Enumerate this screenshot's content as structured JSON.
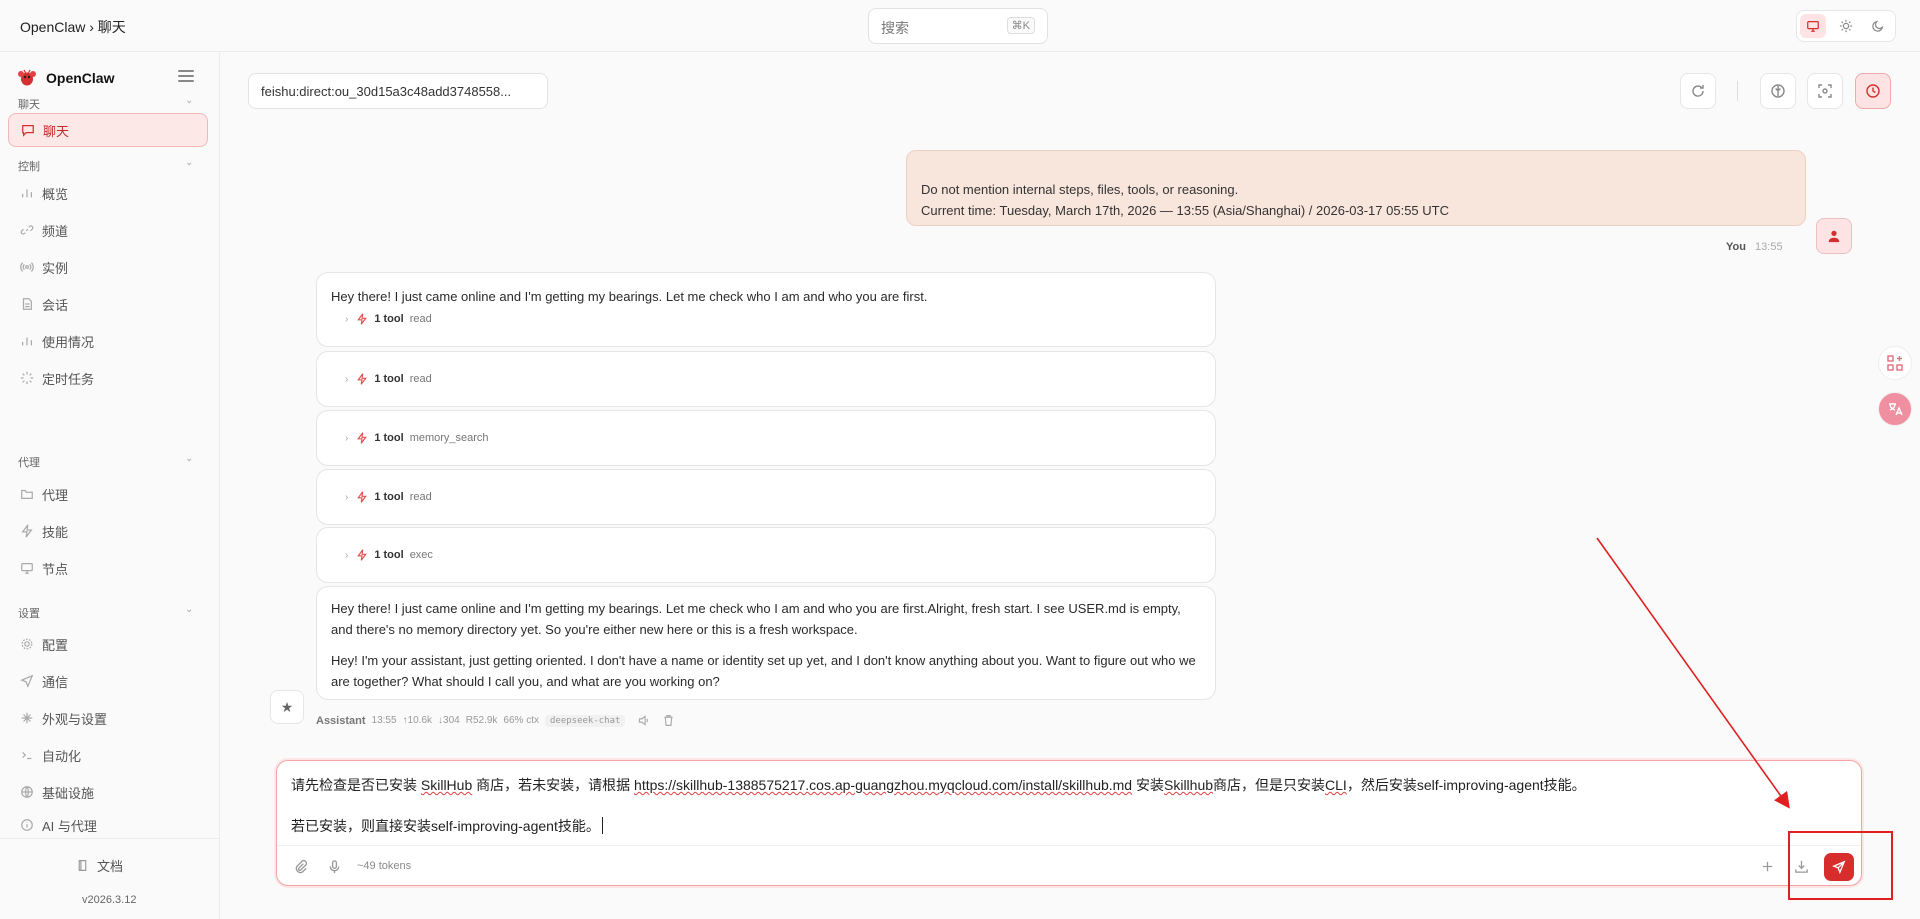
{
  "topbar": {
    "breadcrumb": "OpenClaw › 聊天",
    "search_placeholder": "搜索",
    "search_shortcut": "⌘K",
    "theme_modes": [
      "system-icon",
      "light-icon",
      "dark-icon"
    ]
  },
  "sidebar": {
    "brand": "OpenClaw",
    "sections": [
      {
        "label": "聊天",
        "items": [
          {
            "label": "聊天",
            "icon": "chat-icon",
            "active": true
          }
        ]
      },
      {
        "label": "控制",
        "items": [
          {
            "label": "概览",
            "icon": "bar-chart-icon"
          },
          {
            "label": "频道",
            "icon": "link-icon"
          },
          {
            "label": "实例",
            "icon": "broadcast-icon"
          },
          {
            "label": "会话",
            "icon": "document-icon"
          },
          {
            "label": "使用情况",
            "icon": "bar-chart-icon"
          },
          {
            "label": "定时任务",
            "icon": "loader-icon"
          }
        ]
      },
      {
        "label": "代理",
        "items": [
          {
            "label": "代理",
            "icon": "folder-icon"
          },
          {
            "label": "技能",
            "icon": "bolt-icon"
          },
          {
            "label": "节点",
            "icon": "monitor-icon"
          }
        ]
      },
      {
        "label": "设置",
        "items": [
          {
            "label": "配置",
            "icon": "gear-icon"
          },
          {
            "label": "通信",
            "icon": "send-icon"
          },
          {
            "label": "外观与设置",
            "icon": "sparkle-icon"
          },
          {
            "label": "自动化",
            "icon": "terminal-icon"
          },
          {
            "label": "基础设施",
            "icon": "globe-icon"
          },
          {
            "label": "AI 与代理",
            "icon": "info-icon"
          }
        ]
      }
    ],
    "docs_label": "文档",
    "version": "v2026.3.12"
  },
  "chat_header": {
    "session": "feishu:direct:ou_30d15a3c48add3748558..."
  },
  "user_message": {
    "lines": [
      "Do not mention internal steps, files, tools, or reasoning.",
      "Current time: Tuesday, March 17th, 2026 — 13:55 (Asia/Shanghai) / 2026-03-17 05:55 UTC"
    ],
    "author": "You",
    "time": "13:55"
  },
  "assistant": {
    "first_text": "Hey there! I just came online and I'm getting my bearings. Let me check who I am and who you are first.",
    "tools": [
      {
        "count": "1 tool",
        "name": "read"
      },
      {
        "count": "1 tool",
        "name": "read"
      },
      {
        "count": "1 tool",
        "name": "memory_search"
      },
      {
        "count": "1 tool",
        "name": "read"
      },
      {
        "count": "1 tool",
        "name": "exec"
      }
    ],
    "final_p1": "Hey there! I just came online and I'm getting my bearings. Let me check who I am and who you are first.Alright, fresh start. I see USER.md is empty, and there's no memory directory yet. So you're either new here or this is a fresh workspace.",
    "final_p2": "Hey! I'm your assistant, just getting oriented. I don't have a name or identity set up yet, and I don't know anything about you. Want to figure out who we are together? What should I call you, and what are you working on?",
    "meta": {
      "author": "Assistant",
      "time": "13:55",
      "in_tokens": "↑10.6k",
      "out_tokens": "↓304",
      "cache": "R52.9k",
      "ctx": "66% ctx",
      "model": "deepseek-chat"
    }
  },
  "composer": {
    "line1_parts": [
      {
        "t": "请先检查是否已安装 ",
        "s": false
      },
      {
        "t": "SkillHub",
        "s": true
      },
      {
        "t": " 商店，若未安装，请根据 ",
        "s": false
      },
      {
        "t": "https://skillhub-1388575217.cos.ap-guangzhou.myqcloud.com/install/skillhub.md",
        "s": true
      },
      {
        "t": " 安装",
        "s": false
      },
      {
        "t": "Skillhub",
        "s": true
      },
      {
        "t": "商店，但是只安装",
        "s": false
      },
      {
        "t": "CLI",
        "s": true
      },
      {
        "t": "，然后安装self-improving-agent技能。",
        "s": false
      }
    ],
    "line2": "若已安装，则直接安装self-improving-agent技能。",
    "tokens": "~49 tokens"
  }
}
